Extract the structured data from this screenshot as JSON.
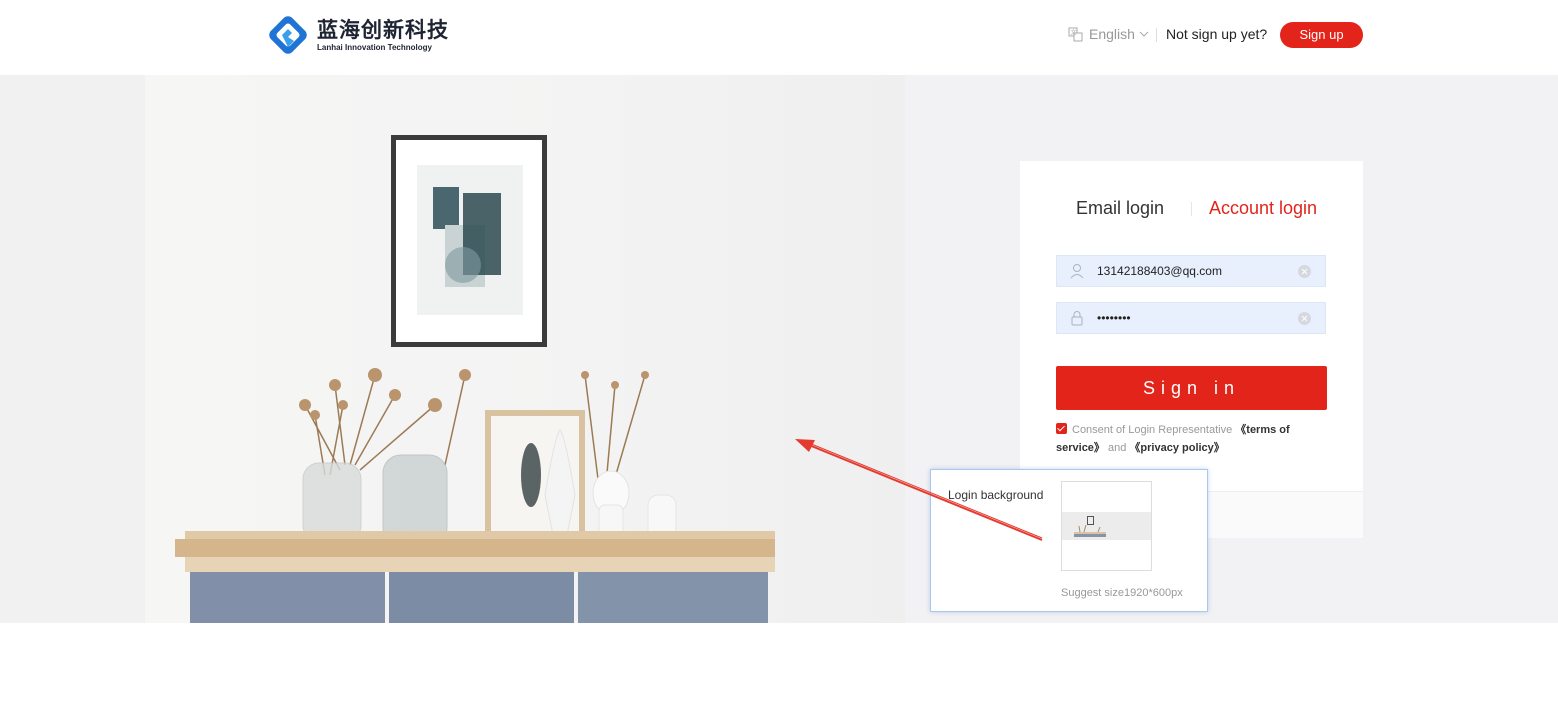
{
  "header": {
    "logo_cn": "蓝海创新科技",
    "logo_en": "Lanhai Innovation Technology",
    "language": "English",
    "not_signed_text": "Not sign up yet?",
    "signup_label": "Sign up"
  },
  "login": {
    "tab_email": "Email login",
    "tab_account": "Account login",
    "username_value": "13142188403@qq.com",
    "password_value": "12345678",
    "signin_label": "Sign in",
    "consent_text": "Consent of Login Representative",
    "terms_label": "《terms of service》",
    "and_text": "and",
    "privacy_label": "《privacy policy》",
    "consent_checked": true
  },
  "background_panel": {
    "label": "Login background",
    "hint": "Suggest size1920*600px"
  },
  "colors": {
    "brand_red": "#e3241b",
    "logo_blue": "#1f74d6",
    "field_bg": "#e8effd"
  },
  "icons": [
    "logo-mark-icon",
    "translate-icon",
    "chevron-down-icon",
    "user-icon",
    "lock-icon",
    "clear-icon",
    "checkbox-icon",
    "arrow-annotation"
  ]
}
